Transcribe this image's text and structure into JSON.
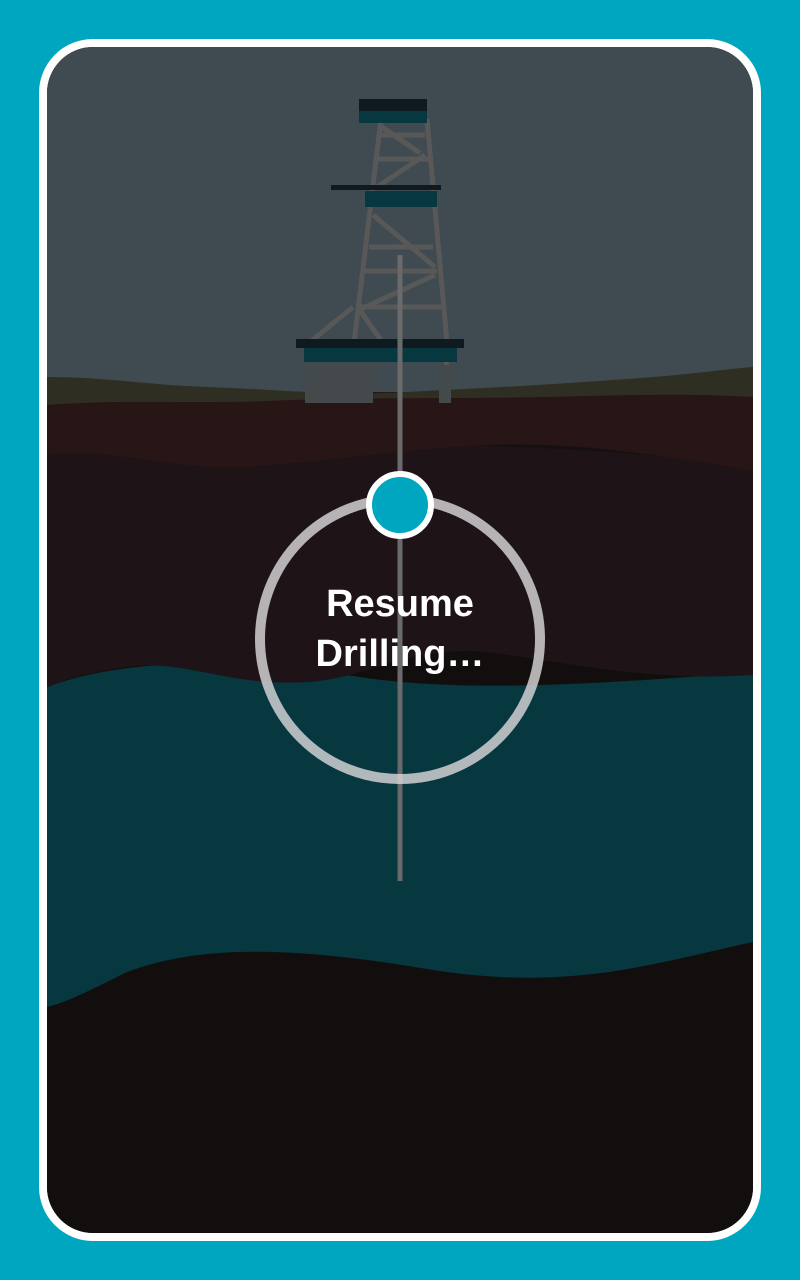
{
  "status": {
    "line1": "Resume",
    "line2": "Drilling…"
  },
  "drill_progress": 0.0,
  "colors": {
    "background": "#00a5c0",
    "frame_border": "#ffffff",
    "sky": "#3f4b50",
    "ground_top": "#2f2e22",
    "soil": "#281515",
    "rock": "#1e1316",
    "water_layer": "#07373f",
    "bedrock": "#130e0e",
    "accent": "#00a5c0"
  },
  "icons": {
    "rig": "oil-derrick-icon",
    "progress": "progress-ring-icon",
    "pipe": "drill-pipe-icon"
  }
}
